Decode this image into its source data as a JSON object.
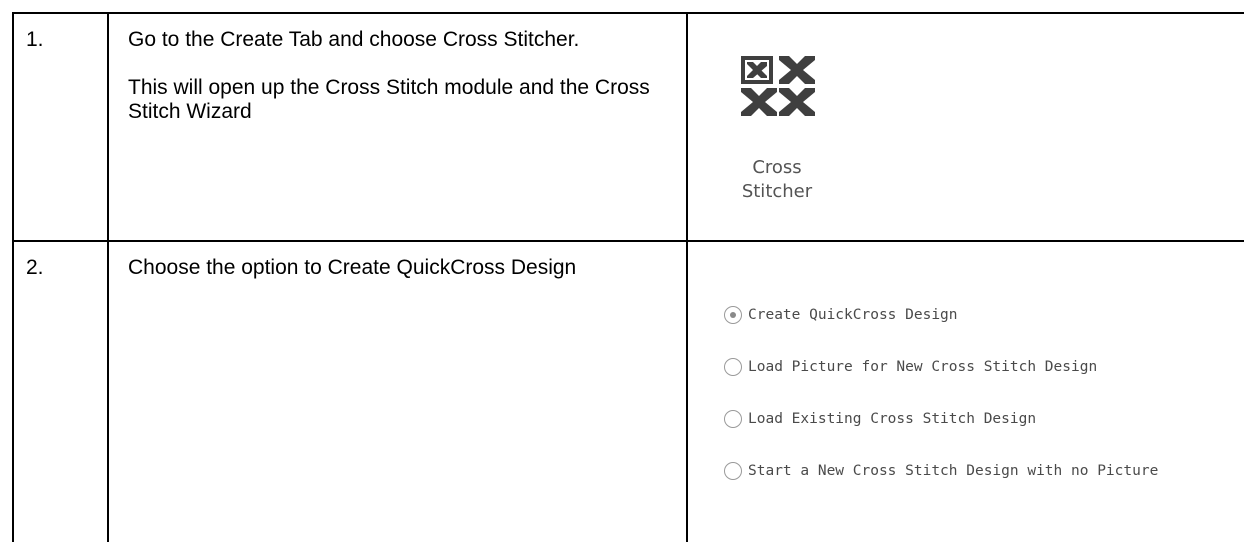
{
  "steps": [
    {
      "number": "1.",
      "lines": [
        "Go to the Create Tab and choose Cross Stitcher.",
        "This will open up the Cross Stitch module and the Cross Stitch Wizard"
      ]
    },
    {
      "number": "2.",
      "lines": [
        "Choose the option to Create QuickCross Design"
      ]
    }
  ],
  "cross_stitcher": {
    "icon": "cross-stitch-icon",
    "label_line1": "Cross",
    "label_line2": "Stitcher",
    "icon_color": "#3f3f3f"
  },
  "wizard_options": {
    "selected": "Create QuickCross Design",
    "items": [
      {
        "label": "Create QuickCross Design",
        "checked": true
      },
      {
        "label": "Load Picture for New Cross Stitch Design",
        "checked": false
      },
      {
        "label": "Load Existing Cross Stitch Design",
        "checked": false
      },
      {
        "label": "Start a New Cross Stitch Design with no Picture",
        "checked": false
      }
    ]
  }
}
